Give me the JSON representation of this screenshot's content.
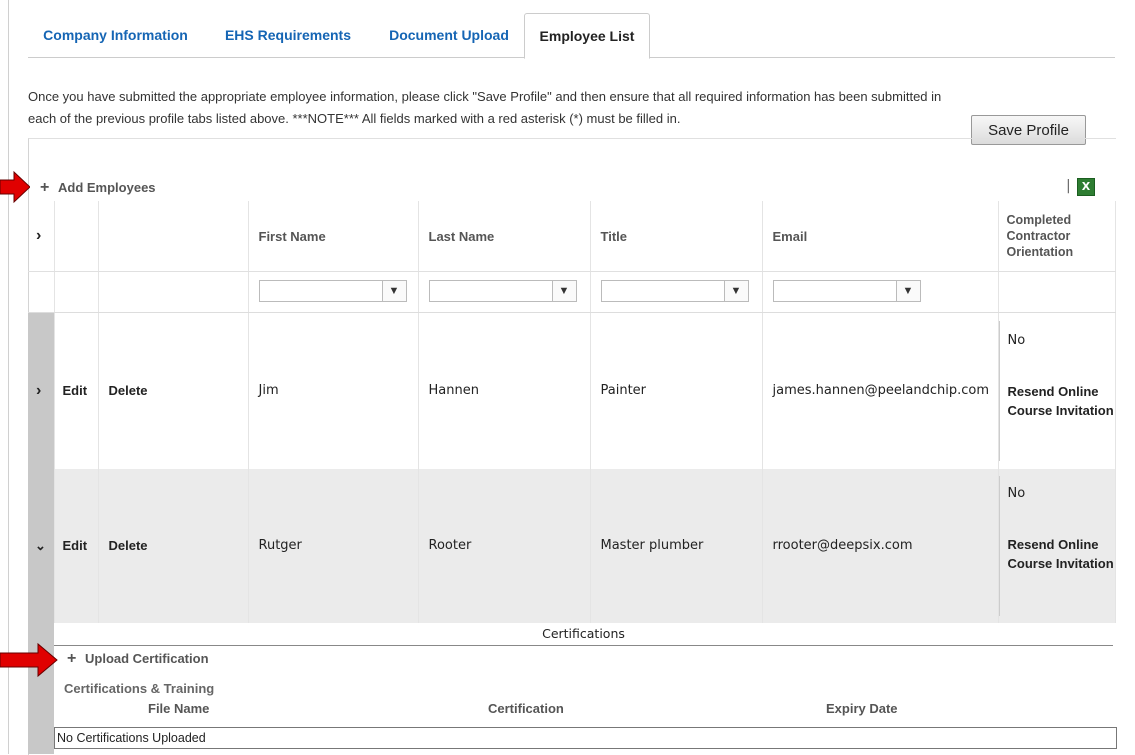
{
  "tabs": [
    {
      "label": "Company Information",
      "active": false
    },
    {
      "label": "EHS Requirements",
      "active": false
    },
    {
      "label": "Document Upload",
      "active": false
    },
    {
      "label": "Employee List",
      "active": true
    }
  ],
  "instructions": "Once you have submitted the appropriate employee information, please click \"Save Profile\" and then ensure that all required information has been submitted in each of the previous profile tabs listed above. ***NOTE*** All fields marked with a red asterisk (*) must be filled in.",
  "save_button": "Save Profile",
  "toolbar": {
    "add_label": "Add Employees",
    "separator": "|",
    "export_icon": "excel-export-icon"
  },
  "columns": [
    "First Name",
    "Last Name",
    "Title",
    "Email",
    "Completed Contractor Orientation"
  ],
  "rows": [
    {
      "expanded": false,
      "edit": "Edit",
      "delete": "Delete",
      "first": "Jim",
      "last": "Hannen",
      "title": "Painter",
      "email": "james.hannen@peelandchip.com",
      "orientation": "No",
      "resend": "Resend Online Course Invitation"
    },
    {
      "expanded": true,
      "edit": "Edit",
      "delete": "Delete",
      "first": "Rutger",
      "last": "Rooter",
      "title": "Master plumber",
      "email": "rrooter@deepsix.com",
      "orientation": "No",
      "resend": "Resend Online Course Invitation"
    }
  ],
  "details": {
    "title": "Certifications",
    "upload_label": "Upload Certification",
    "section_label": "Certifications & Training",
    "columns": [
      "File Name",
      "Certification",
      "Expiry Date"
    ],
    "empty_text": "No Certifications Uploaded"
  },
  "colors": {
    "tab_link": "#1565b4",
    "arrow": "#e00000",
    "expander": "#c8c8c8"
  }
}
